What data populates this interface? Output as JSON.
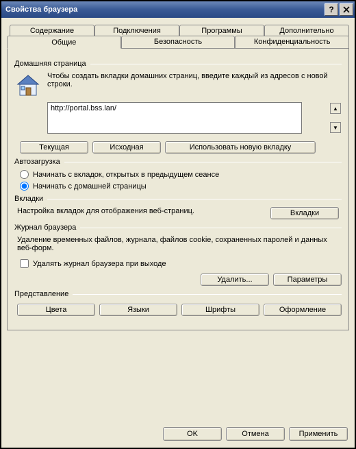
{
  "window": {
    "title": "Свойства браузера"
  },
  "tabs_back": {
    "content": "Содержание",
    "connections": "Подключения",
    "programs": "Программы",
    "advanced": "Дополнительно"
  },
  "tabs_front": {
    "general": "Общие",
    "security": "Безопасность",
    "privacy": "Конфиденциальность"
  },
  "home": {
    "legend": "Домашняя страница",
    "instr": "Чтобы создать вкладки домашних страниц, введите каждый из адресов с новой строки.",
    "url": "http://portal.bss.lan/",
    "btn_current": "Текущая",
    "btn_default": "Исходная",
    "btn_newtab": "Использовать новую вкладку"
  },
  "startup": {
    "legend": "Автозагрузка",
    "opt_last": "Начинать с вкладок, открытых в предыдущем сеансе",
    "opt_home": "Начинать с домашней страницы"
  },
  "tabsg": {
    "legend": "Вкладки",
    "desc": "Настройка вкладок для отображения веб-страниц.",
    "btn": "Вкладки"
  },
  "history": {
    "legend": "Журнал браузера",
    "desc": "Удаление временных файлов, журнала, файлов cookie, сохраненных паролей и данных веб-форм.",
    "chk": "Удалять журнал браузера при выходе",
    "btn_delete": "Удалить...",
    "btn_settings": "Параметры"
  },
  "appearance": {
    "legend": "Представление",
    "btn_colors": "Цвета",
    "btn_lang": "Языки",
    "btn_fonts": "Шрифты",
    "btn_access": "Оформление"
  },
  "footer": {
    "ok": "OK",
    "cancel": "Отмена",
    "apply": "Применить"
  }
}
